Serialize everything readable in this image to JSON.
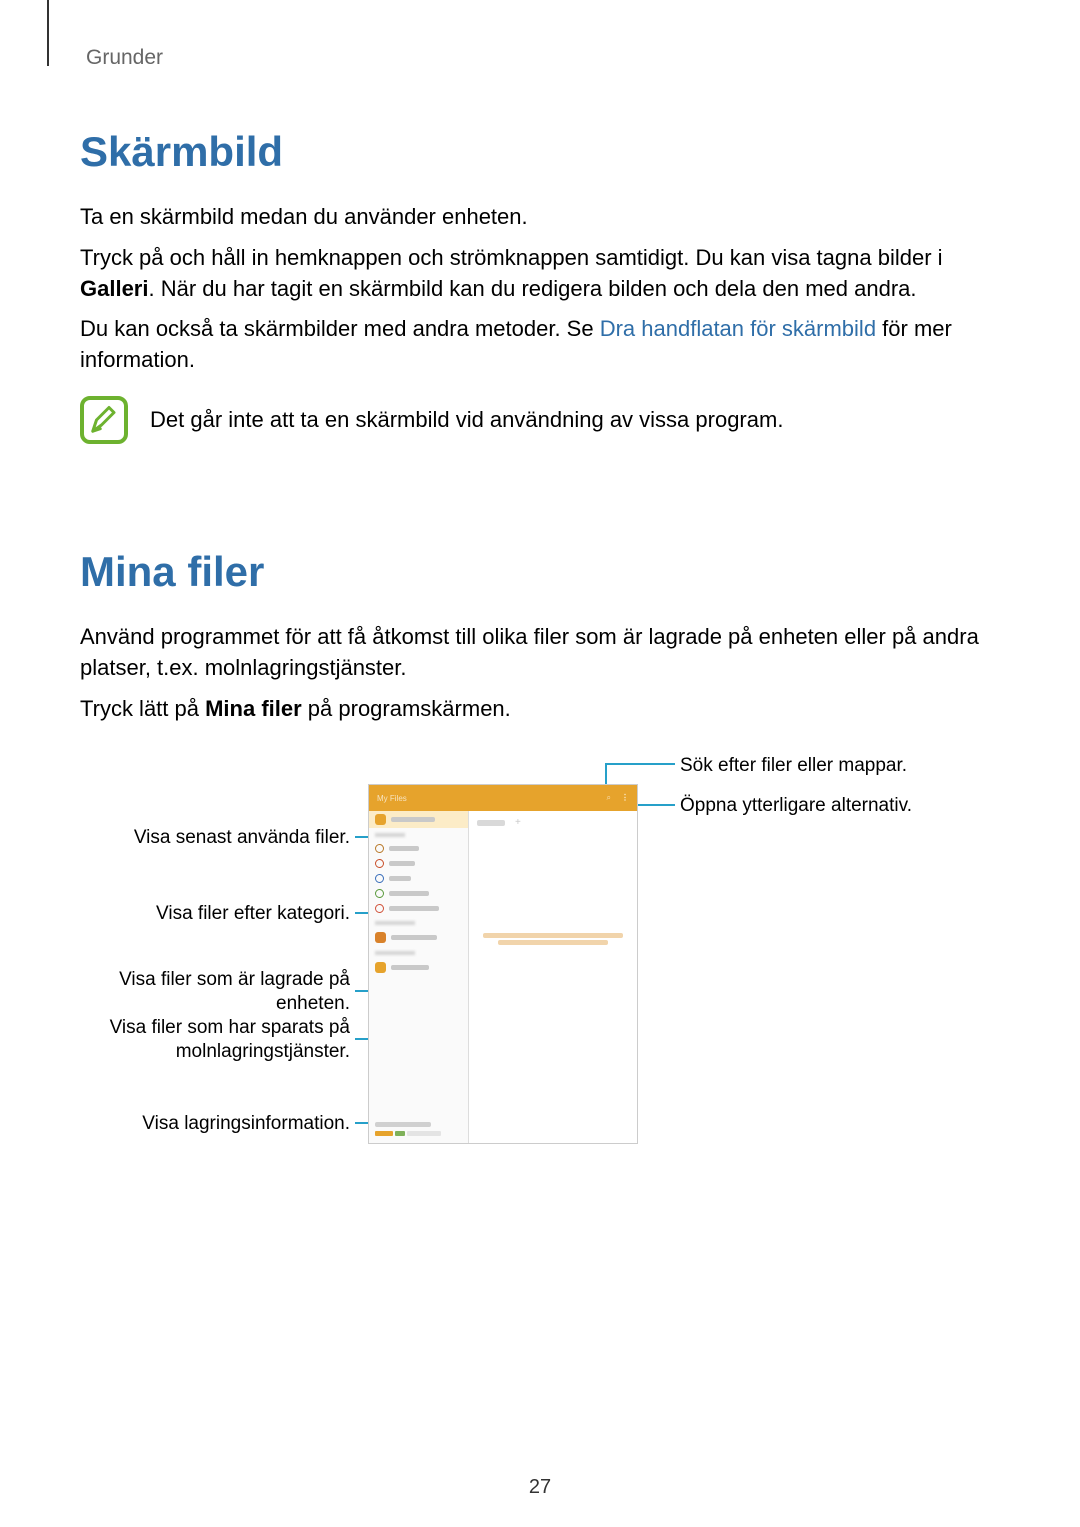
{
  "breadcrumb": "Grunder",
  "section1": {
    "title": "Skärmbild",
    "p1": "Ta en skärmbild medan du använder enheten.",
    "p2_a": "Tryck på och håll in hemknappen och strömknappen samtidigt. Du kan visa tagna bilder i ",
    "p2_bold": "Galleri",
    "p2_b": ". När du har tagit en skärmbild kan du redigera bilden och dela den med andra.",
    "p3_a": "Du kan också ta skärmbilder med andra metoder. Se ",
    "p3_link": "Dra handflatan för skärmbild",
    "p3_b": " för mer information.",
    "note": "Det går inte att ta en skärmbild vid användning av vissa program."
  },
  "section2": {
    "title": "Mina filer",
    "p1": "Använd programmet för att få åtkomst till olika filer som är lagrade på enheten eller på andra platser, t.ex. molnlagringstjänster.",
    "p2_a": "Tryck lätt på ",
    "p2_bold": "Mina filer",
    "p2_b": " på programskärmen."
  },
  "callouts": {
    "left1": "Visa senast använda filer.",
    "left2": "Visa filer efter kategori.",
    "left3": "Visa filer som är lagrade på\nenheten.",
    "left4": "Visa filer som har sparats på\nmolnlagringstjänster.",
    "left5": "Visa lagringsinformation.",
    "right1": "Sök efter filer eller mappar.",
    "right2": "Öppna ytterligare alternativ."
  },
  "page_number": "27"
}
